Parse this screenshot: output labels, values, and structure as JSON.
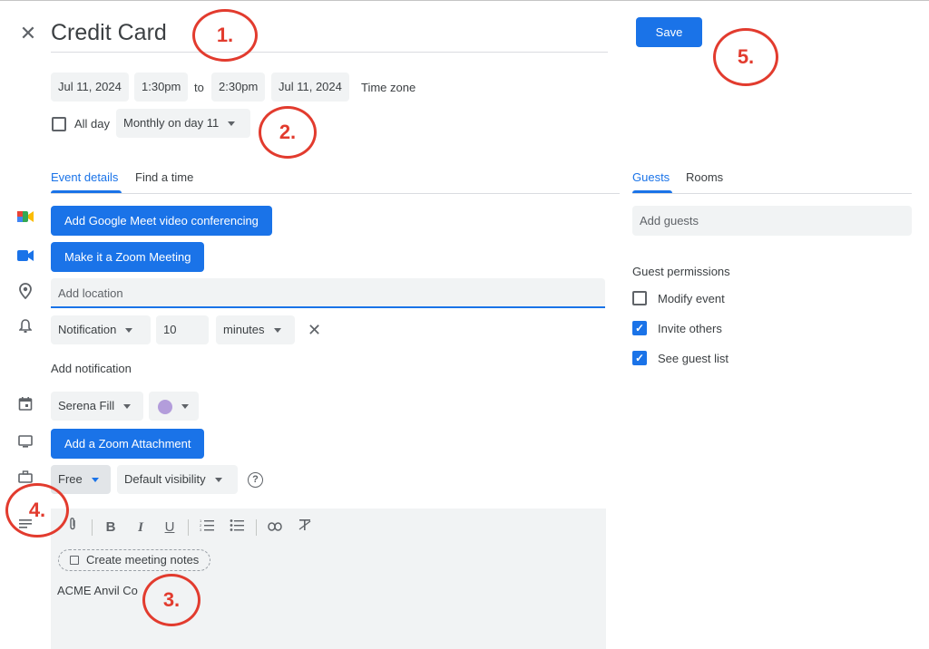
{
  "header": {
    "title": "Credit Card",
    "save_label": "Save"
  },
  "datetime": {
    "start_date": "Jul 11, 2024",
    "start_time": "1:30pm",
    "to": "to",
    "end_time": "2:30pm",
    "end_date": "Jul 11, 2024",
    "timezone_label": "Time zone",
    "all_day_label": "All day",
    "recurrence": "Monthly on day 11"
  },
  "tabs": {
    "event_details": "Event details",
    "find_time": "Find a time",
    "guests": "Guests",
    "rooms": "Rooms"
  },
  "details": {
    "meet_button": "Add Google Meet video conferencing",
    "zoom_button": "Make it a Zoom Meeting",
    "location_placeholder": "Add location",
    "notification_type": "Notification",
    "notification_value": "10",
    "notification_unit": "minutes",
    "add_notification": "Add notification",
    "calendar_owner": "Serena Fill",
    "event_color": "#b39ddb",
    "zoom_attachment": "Add a Zoom Attachment",
    "availability": "Free",
    "visibility": "Default visibility"
  },
  "editor": {
    "toolbar": [
      "attach-icon",
      "bold-icon",
      "italic-icon",
      "underline-icon",
      "numbered-list-icon",
      "bulleted-list-icon",
      "link-icon",
      "clear-format-icon"
    ],
    "bold": "B",
    "italic": "I",
    "underline": "U",
    "meeting_notes": "Create meeting notes",
    "body": "ACME Anvil Co"
  },
  "guests": {
    "add_placeholder": "Add guests",
    "permissions_title": "Guest permissions",
    "permissions": [
      {
        "label": "Modify event",
        "checked": false
      },
      {
        "label": "Invite others",
        "checked": true
      },
      {
        "label": "See guest list",
        "checked": true
      }
    ]
  },
  "annotations": {
    "a1": "1.",
    "a2": "2.",
    "a3": "3.",
    "a4": "4.",
    "a5": "5."
  },
  "colors": {
    "accent": "#1a73e8",
    "annotation": "#e23b2e"
  }
}
